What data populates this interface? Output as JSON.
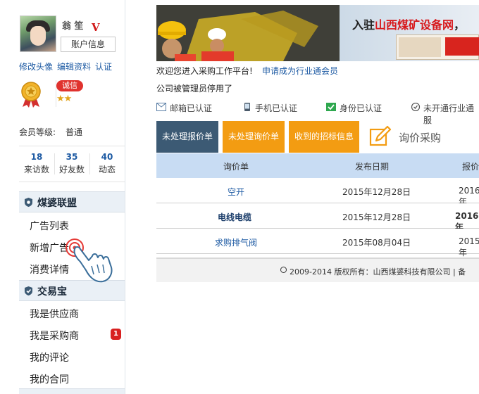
{
  "sidebar": {
    "username": "翁 笙",
    "vip_mark": "V",
    "account_button": "账户信息",
    "links": [
      "修改头像",
      "编辑资料",
      "认证"
    ],
    "honesty_badge": "诚信",
    "stars": "★★",
    "level_label": "会员等级:",
    "level_value": "普通",
    "stats": [
      {
        "num": "18",
        "label": "来访数"
      },
      {
        "num": "35",
        "label": "好友数"
      },
      {
        "num": "40",
        "label": "动态"
      }
    ],
    "sections": [
      {
        "title": "煤婆联盟",
        "items": [
          "广告列表",
          "新增广告",
          "消费详情"
        ]
      },
      {
        "title": "交易宝",
        "items": [
          "我是供应商",
          "我是采购商",
          "我的评论",
          "我的合同"
        ]
      }
    ],
    "purchaser_badge": "1"
  },
  "main": {
    "banner_title_prefix": "入驻",
    "banner_title_red": "山西煤矿设备网",
    "banner_title_suffix": "，",
    "welcome": "欢迎您进入采购工作平台!",
    "welcome_link": "申请成为行业通会员",
    "notice": "公司被管理员停用了",
    "auth": [
      {
        "label": "邮箱已认证",
        "icon": "mail-icon"
      },
      {
        "label": "手机已认证",
        "icon": "phone-icon"
      },
      {
        "label": "身份已认证",
        "icon": "id-check-icon"
      },
      {
        "label": "未开通行业通服",
        "icon": "industry-icon"
      }
    ],
    "tabs": [
      "未处理报价单",
      "未处理询价单",
      "收到的招标信息"
    ],
    "inquiry_label": "询价采购",
    "table": {
      "headers": [
        "询价单",
        "发布日期",
        "报价"
      ],
      "rows": [
        {
          "name": "空开",
          "date": "2015年12月28日",
          "quote": "2016年",
          "bold": false
        },
        {
          "name": "电线电缆",
          "date": "2015年12月28日",
          "quote": "2016年",
          "bold": true
        },
        {
          "name": "求购排气阀",
          "date": "2015年08月04日",
          "quote": "2015年",
          "bold": false
        }
      ]
    },
    "footer": "2009-2014  版权所有：山西煤婆科技有限公司  |  备"
  },
  "colors": {
    "link": "#1d5aa3",
    "tab_active": "#3c5a74",
    "tab_orange": "#f39c12",
    "table_header": "#c8dcf3",
    "badge_red": "#d82020"
  }
}
